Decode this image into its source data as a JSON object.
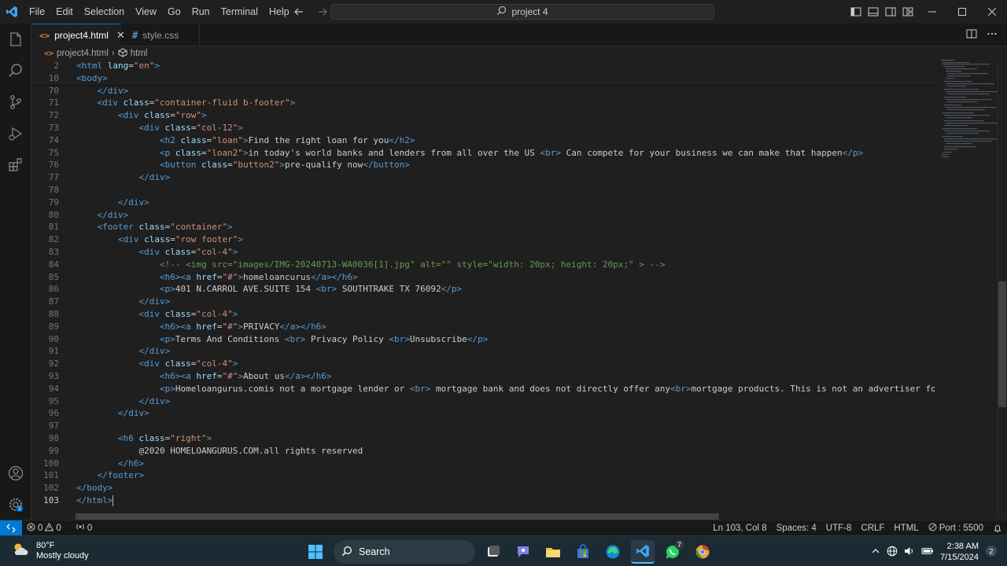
{
  "titlebar": {
    "menu": [
      "File",
      "Edit",
      "Selection",
      "View",
      "Go",
      "Run",
      "Terminal",
      "Help"
    ],
    "search_text": "project 4"
  },
  "tabs": [
    {
      "label": "project4.html",
      "active": true
    },
    {
      "label": "style.css",
      "active": false
    }
  ],
  "breadcrumb": {
    "file": "project4.html",
    "symbol": "html"
  },
  "editor": {
    "current_line": "103",
    "lines": [
      {
        "n": "2",
        "tokens": [
          [
            "tag",
            "<"
          ],
          [
            "tag",
            "html"
          ],
          [
            "txt",
            " "
          ],
          [
            "attr",
            "lang"
          ],
          [
            "txt",
            "="
          ],
          [
            "str",
            "\"en\""
          ],
          [
            "tag",
            ">"
          ]
        ]
      },
      {
        "n": "10",
        "tokens": [
          [
            "tag",
            "<body>"
          ]
        ]
      },
      {
        "n": "70",
        "tokens": [
          [
            "txt",
            "    "
          ],
          [
            "tag",
            "</div>"
          ]
        ]
      },
      {
        "n": "71",
        "tokens": [
          [
            "txt",
            "    "
          ],
          [
            "tag",
            "<div"
          ],
          [
            "txt",
            " "
          ],
          [
            "attr",
            "class"
          ],
          [
            "txt",
            "="
          ],
          [
            "str",
            "\"container-fluid b-footer\""
          ],
          [
            "tag",
            ">"
          ]
        ]
      },
      {
        "n": "72",
        "tokens": [
          [
            "txt",
            "        "
          ],
          [
            "tag",
            "<div"
          ],
          [
            "txt",
            " "
          ],
          [
            "attr",
            "class"
          ],
          [
            "txt",
            "="
          ],
          [
            "str",
            "\"row\""
          ],
          [
            "tag",
            ">"
          ]
        ]
      },
      {
        "n": "73",
        "tokens": [
          [
            "txt",
            "            "
          ],
          [
            "tag",
            "<div"
          ],
          [
            "txt",
            " "
          ],
          [
            "attr",
            "class"
          ],
          [
            "txt",
            "="
          ],
          [
            "str",
            "\"col-12\""
          ],
          [
            "tag",
            ">"
          ]
        ]
      },
      {
        "n": "74",
        "tokens": [
          [
            "txt",
            "                "
          ],
          [
            "tag",
            "<h2"
          ],
          [
            "txt",
            " "
          ],
          [
            "attr",
            "class"
          ],
          [
            "txt",
            "="
          ],
          [
            "str",
            "\"loan\""
          ],
          [
            "tag",
            ">"
          ],
          [
            "txt",
            "Find the right loan for you"
          ],
          [
            "tag",
            "</h2>"
          ]
        ]
      },
      {
        "n": "75",
        "tokens": [
          [
            "txt",
            "                "
          ],
          [
            "tag",
            "<p"
          ],
          [
            "txt",
            " "
          ],
          [
            "attr",
            "class"
          ],
          [
            "txt",
            "="
          ],
          [
            "str",
            "\"loan2\""
          ],
          [
            "tag",
            ">"
          ],
          [
            "txt",
            "in today's world banks and lenders from all over the US "
          ],
          [
            "tag",
            "<br>"
          ],
          [
            "txt",
            " Can compete for your business we can make that happen"
          ],
          [
            "tag",
            "</p>"
          ]
        ]
      },
      {
        "n": "76",
        "tokens": [
          [
            "txt",
            "                "
          ],
          [
            "tag",
            "<button"
          ],
          [
            "txt",
            " "
          ],
          [
            "attr",
            "class"
          ],
          [
            "txt",
            "="
          ],
          [
            "str",
            "\"button2\""
          ],
          [
            "tag",
            ">"
          ],
          [
            "txt",
            "pre-qualify now"
          ],
          [
            "tag",
            "</button>"
          ]
        ]
      },
      {
        "n": "77",
        "tokens": [
          [
            "txt",
            "            "
          ],
          [
            "tag",
            "</div>"
          ]
        ]
      },
      {
        "n": "78",
        "tokens": []
      },
      {
        "n": "79",
        "tokens": [
          [
            "txt",
            "        "
          ],
          [
            "tag",
            "</div>"
          ]
        ]
      },
      {
        "n": "80",
        "tokens": [
          [
            "txt",
            "    "
          ],
          [
            "tag",
            "</div>"
          ]
        ]
      },
      {
        "n": "81",
        "tokens": [
          [
            "txt",
            "    "
          ],
          [
            "tag",
            "<footer"
          ],
          [
            "txt",
            " "
          ],
          [
            "attr",
            "class"
          ],
          [
            "txt",
            "="
          ],
          [
            "str",
            "\"container\""
          ],
          [
            "tag",
            ">"
          ]
        ]
      },
      {
        "n": "82",
        "tokens": [
          [
            "txt",
            "        "
          ],
          [
            "tag",
            "<div"
          ],
          [
            "txt",
            " "
          ],
          [
            "attr",
            "class"
          ],
          [
            "txt",
            "="
          ],
          [
            "str",
            "\"row footer\""
          ],
          [
            "tag",
            ">"
          ]
        ]
      },
      {
        "n": "83",
        "tokens": [
          [
            "txt",
            "            "
          ],
          [
            "tag",
            "<div"
          ],
          [
            "txt",
            " "
          ],
          [
            "attr",
            "class"
          ],
          [
            "txt",
            "="
          ],
          [
            "str",
            "\"col-4\""
          ],
          [
            "tag",
            ">"
          ]
        ]
      },
      {
        "n": "84",
        "tokens": [
          [
            "txt",
            "                "
          ],
          [
            "cmt",
            "<!-- <img src=\"images/IMG-20240713-WA0036[1].jpg\" alt=\"\" style=\"width: 20px; height: 20px;\" > -->"
          ]
        ]
      },
      {
        "n": "85",
        "tokens": [
          [
            "txt",
            "                "
          ],
          [
            "tag",
            "<h6><a"
          ],
          [
            "txt",
            " "
          ],
          [
            "attr",
            "href"
          ],
          [
            "txt",
            "="
          ],
          [
            "str",
            "\"#\""
          ],
          [
            "tag",
            ">"
          ],
          [
            "txt",
            "homeloancurus"
          ],
          [
            "tag",
            "</a></h6>"
          ]
        ]
      },
      {
        "n": "86",
        "tokens": [
          [
            "txt",
            "                "
          ],
          [
            "tag",
            "<p>"
          ],
          [
            "txt",
            "401 N.CARROL AVE.SUITE 154 "
          ],
          [
            "tag",
            "<br>"
          ],
          [
            "txt",
            " SOUTHTRAKE TX 76092"
          ],
          [
            "tag",
            "</p>"
          ]
        ]
      },
      {
        "n": "87",
        "tokens": [
          [
            "txt",
            "            "
          ],
          [
            "tag",
            "</div>"
          ]
        ]
      },
      {
        "n": "88",
        "tokens": [
          [
            "txt",
            "            "
          ],
          [
            "tag",
            "<div"
          ],
          [
            "txt",
            " "
          ],
          [
            "attr",
            "class"
          ],
          [
            "txt",
            "="
          ],
          [
            "str",
            "\"col-4\""
          ],
          [
            "tag",
            ">"
          ]
        ]
      },
      {
        "n": "89",
        "tokens": [
          [
            "txt",
            "                "
          ],
          [
            "tag",
            "<h6><a"
          ],
          [
            "txt",
            " "
          ],
          [
            "attr",
            "href"
          ],
          [
            "txt",
            "="
          ],
          [
            "str",
            "\"#\""
          ],
          [
            "tag",
            ">"
          ],
          [
            "txt",
            "PRIVACY"
          ],
          [
            "tag",
            "</a></h6>"
          ]
        ]
      },
      {
        "n": "90",
        "tokens": [
          [
            "txt",
            "                "
          ],
          [
            "tag",
            "<p>"
          ],
          [
            "txt",
            "Terms And Conditions "
          ],
          [
            "tag",
            "<br>"
          ],
          [
            "txt",
            " Privacy Policy "
          ],
          [
            "tag",
            "<br>"
          ],
          [
            "txt",
            "Unsubscribe"
          ],
          [
            "tag",
            "</p>"
          ]
        ]
      },
      {
        "n": "91",
        "tokens": [
          [
            "txt",
            "            "
          ],
          [
            "tag",
            "</div>"
          ]
        ]
      },
      {
        "n": "92",
        "tokens": [
          [
            "txt",
            "            "
          ],
          [
            "tag",
            "<div"
          ],
          [
            "txt",
            " "
          ],
          [
            "attr",
            "class"
          ],
          [
            "txt",
            "="
          ],
          [
            "str",
            "\"col-4\""
          ],
          [
            "tag",
            ">"
          ]
        ]
      },
      {
        "n": "93",
        "tokens": [
          [
            "txt",
            "                "
          ],
          [
            "tag",
            "<h6><a"
          ],
          [
            "txt",
            " "
          ],
          [
            "attr",
            "href"
          ],
          [
            "txt",
            "="
          ],
          [
            "str",
            "\"#\""
          ],
          [
            "tag",
            ">"
          ],
          [
            "txt",
            "About us"
          ],
          [
            "tag",
            "</a></h6>"
          ]
        ]
      },
      {
        "n": "94",
        "tokens": [
          [
            "txt",
            "                "
          ],
          [
            "tag",
            "<p>"
          ],
          [
            "txt",
            "Homeloangurus.comis not a mortgage lender or "
          ],
          [
            "tag",
            "<br>"
          ],
          [
            "txt",
            " mortgage bank and does not directly offer any"
          ],
          [
            "tag",
            "<br>"
          ],
          [
            "txt",
            "mortgage products. This is not an advertiser for for"
          ]
        ]
      },
      {
        "n": "95",
        "tokens": [
          [
            "txt",
            "            "
          ],
          [
            "tag",
            "</div>"
          ]
        ]
      },
      {
        "n": "96",
        "tokens": [
          [
            "txt",
            "        "
          ],
          [
            "tag",
            "</div>"
          ]
        ]
      },
      {
        "n": "97",
        "tokens": []
      },
      {
        "n": "98",
        "tokens": [
          [
            "txt",
            "        "
          ],
          [
            "tag",
            "<h6"
          ],
          [
            "txt",
            " "
          ],
          [
            "attr",
            "class"
          ],
          [
            "txt",
            "="
          ],
          [
            "str",
            "\"right\""
          ],
          [
            "tag",
            ">"
          ]
        ]
      },
      {
        "n": "99",
        "tokens": [
          [
            "txt",
            "            @2020 HOMELOANGURUS.COM.all rights reserved"
          ]
        ]
      },
      {
        "n": "100",
        "tokens": [
          [
            "txt",
            "        "
          ],
          [
            "tag",
            "</h6>"
          ]
        ]
      },
      {
        "n": "101",
        "tokens": [
          [
            "txt",
            "    "
          ],
          [
            "tag",
            "</footer>"
          ]
        ]
      },
      {
        "n": "102",
        "tokens": [
          [
            "tag",
            "</body>"
          ]
        ]
      },
      {
        "n": "103",
        "tokens": [
          [
            "tag",
            "</html>"
          ]
        ]
      }
    ]
  },
  "statusbar": {
    "errors": "0",
    "warnings": "0",
    "ports_count": "0",
    "position": "Ln 103, Col 8",
    "spaces": "Spaces: 4",
    "encoding": "UTF-8",
    "eol": "CRLF",
    "language": "HTML",
    "port": "Port : 5500"
  },
  "taskbar": {
    "temperature": "80°F",
    "weather": "Mostly cloudy",
    "search_label": "Search",
    "whatsapp_badge": "7",
    "time": "2:38 AM",
    "date": "7/15/2024",
    "notification_count": "2"
  },
  "colors": {
    "accent": "#0078d4",
    "tag": "#569cd6",
    "attribute": "#9cdcfe",
    "string": "#ce9178",
    "comment": "#6a9955",
    "text": "#cccccc"
  }
}
